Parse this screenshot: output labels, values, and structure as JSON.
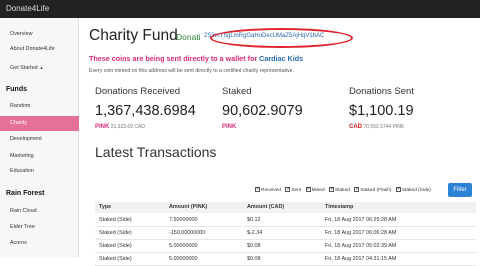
{
  "app": {
    "brand": "Donate4Life"
  },
  "sidebar": {
    "items_top": [
      {
        "label": "Overview",
        "active": false
      },
      {
        "label": "About Donate4Life",
        "active": false
      },
      {
        "label": "Get Started",
        "active": false
      }
    ],
    "funds_heading": "Funds",
    "funds": [
      {
        "label": "Random",
        "active": false
      },
      {
        "label": "Charity",
        "active": true
      },
      {
        "label": "Development",
        "active": false
      },
      {
        "label": "Marketing",
        "active": false
      },
      {
        "label": "Education",
        "active": false
      }
    ],
    "rainforest_heading": "Rain Forest",
    "rainforest": [
      {
        "label": "Rain Cloud",
        "active": false
      },
      {
        "label": "Elder Tree",
        "active": false
      },
      {
        "label": "Acorns",
        "active": false
      }
    ]
  },
  "page": {
    "title": "Charity Fund",
    "title_tag": "Donati",
    "address": "2S3mYngLmRgGaHoDecUMaZ5AjHqV1bAC",
    "notice_prefix": "These coins are being sent directly to a wallet for ",
    "notice_highlight": "Cardiac Kids",
    "subnote": "Every coin minted on this address will be sent directly to a certified charity representative."
  },
  "stats": [
    {
      "heading": "Donations Received",
      "value": "1,367,438.6984",
      "unit": "PINK",
      "sub": "21,323.69 CAD"
    },
    {
      "heading": "Staked",
      "value": "90,602.9079",
      "unit": "PINK",
      "sub": ""
    },
    {
      "heading": "Donations Sent",
      "value": "$1,100.19",
      "unit": "CAD",
      "sub": "70,552.5744 PINK"
    }
  ],
  "transactions": {
    "title": "Latest Transactions",
    "filters": [
      "Received",
      "Sent",
      "Mined",
      "Staked",
      "Staked (Flash)",
      "Staked (Side)"
    ],
    "filter_button": "Filter",
    "columns": [
      "Type",
      "Amount (PINK)",
      "Amount (CAD)",
      "Timestamp"
    ],
    "rows": [
      [
        "Staked (Side)",
        "7.50000000",
        "$0.12",
        "Fri, 18 Aug 2017 06:25:28 AM"
      ],
      [
        "Staked (Side)",
        "-150.00000000",
        "$-2.34",
        "Fri, 18 Aug 2017 06:06:28 AM"
      ],
      [
        "Staked (Side)",
        "5.00000000",
        "$0.08",
        "Fri, 18 Aug 2017 05:02:39 AM"
      ],
      [
        "Staked (Side)",
        "5.00000000",
        "$0.08",
        "Fri, 18 Aug 2017 04:31:15 AM"
      ]
    ]
  }
}
